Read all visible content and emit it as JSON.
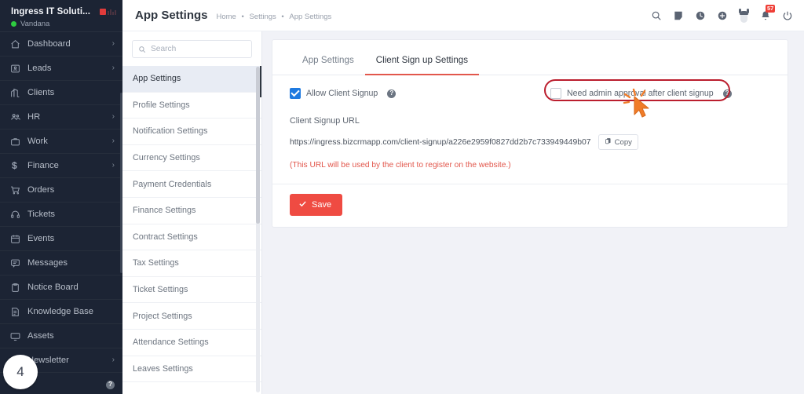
{
  "sidebar": {
    "brand": {
      "name": "Ingress IT Soluti...",
      "user": "Vandana",
      "status_color": "#2ecc40"
    },
    "items": [
      {
        "label": "Dashboard",
        "icon": "home-icon",
        "chevron": "›"
      },
      {
        "label": "Leads",
        "icon": "leads-icon",
        "chevron": "›"
      },
      {
        "label": "Clients",
        "icon": "clients-icon",
        "chevron": ""
      },
      {
        "label": "HR",
        "icon": "hr-icon",
        "chevron": "›"
      },
      {
        "label": "Work",
        "icon": "work-icon",
        "chevron": "›"
      },
      {
        "label": "Finance",
        "icon": "finance-icon",
        "chevron": "›"
      },
      {
        "label": "Orders",
        "icon": "orders-icon",
        "chevron": ""
      },
      {
        "label": "Tickets",
        "icon": "tickets-icon",
        "chevron": ""
      },
      {
        "label": "Events",
        "icon": "events-icon",
        "chevron": ""
      },
      {
        "label": "Messages",
        "icon": "messages-icon",
        "chevron": ""
      },
      {
        "label": "Notice Board",
        "icon": "notice-board-icon",
        "chevron": ""
      },
      {
        "label": "Knowledge Base",
        "icon": "knowledge-base-icon",
        "chevron": ""
      },
      {
        "label": "Assets",
        "icon": "assets-icon",
        "chevron": ""
      },
      {
        "label": "Newsletter",
        "icon": "newsletter-icon",
        "chevron": "›"
      }
    ],
    "footer_help": "?",
    "step_badge": "4"
  },
  "topbar": {
    "title": "App Settings",
    "breadcrumb": [
      "Home",
      "Settings",
      "App Settings"
    ],
    "breadcrumb_sep": "•",
    "icons": [
      {
        "name": "search-icon"
      },
      {
        "name": "note-icon"
      },
      {
        "name": "clock-icon"
      },
      {
        "name": "plus-circle-icon"
      },
      {
        "name": "mouse-icon"
      },
      {
        "name": "bell-icon",
        "badge": "57"
      },
      {
        "name": "power-icon"
      }
    ],
    "badge_color": "#ef3e36"
  },
  "settings_panel": {
    "search": {
      "placeholder": "Search",
      "value": ""
    },
    "items": [
      "App Settings",
      "Profile Settings",
      "Notification Settings",
      "Currency Settings",
      "Payment Credentials",
      "Finance Settings",
      "Contract Settings",
      "Tax Settings",
      "Ticket Settings",
      "Project Settings",
      "Attendance Settings",
      "Leaves Settings"
    ],
    "active_index": 0
  },
  "main": {
    "tabs": [
      {
        "label": "App Settings",
        "active": false
      },
      {
        "label": "Client Sign up Settings",
        "active": true
      }
    ],
    "accent_color": "#e2574c",
    "allow_signup": {
      "label": "Allow Client Signup",
      "checked": true,
      "help": "?"
    },
    "admin_approval": {
      "label": "Need admin approval after client signup",
      "checked": false,
      "help": "?"
    },
    "url_field_label": "Client Signup URL",
    "url_value": "https://ingress.bizcrmapp.com/client-signup/a226e2959f0827dd2b7c733949449b07",
    "copy_label": "Copy",
    "note": "(This URL will be used by the client to register on the website.)",
    "save_label": "Save"
  },
  "annotation": {
    "highlight_color": "#bb1e2e",
    "cursor_color": "#f07c28",
    "target": "Need admin approval after client signup"
  }
}
